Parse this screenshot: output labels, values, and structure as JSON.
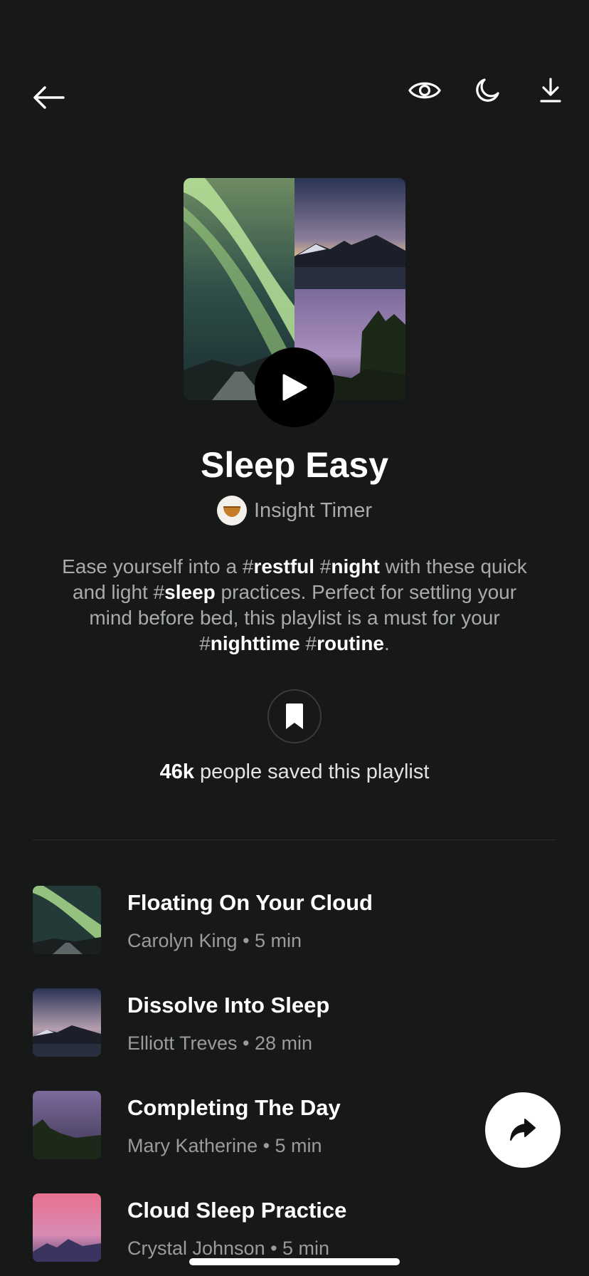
{
  "header": {
    "back_icon": "arrow-left-icon",
    "actions": [
      {
        "icon": "eye-icon"
      },
      {
        "icon": "moon-icon"
      },
      {
        "icon": "download-icon"
      }
    ]
  },
  "playlist": {
    "title": "Sleep Easy",
    "author": "Insight Timer",
    "description_parts": [
      {
        "text": "Ease yourself into a ",
        "tag": false
      },
      {
        "text": "#",
        "tag": false
      },
      {
        "text": "restful",
        "tag": true
      },
      {
        "text": " #",
        "tag": false
      },
      {
        "text": "night",
        "tag": true
      },
      {
        "text": " with these quick and light #",
        "tag": false
      },
      {
        "text": "sleep",
        "tag": true
      },
      {
        "text": " practices. Perfect for settling your mind before bed, this playlist is a must for your #",
        "tag": false
      },
      {
        "text": "nighttime",
        "tag": true
      },
      {
        "text": " #",
        "tag": false
      },
      {
        "text": "routine",
        "tag": true
      },
      {
        "text": ".",
        "tag": false
      }
    ],
    "saved_count": "46k",
    "saved_suffix": " people saved this playlist"
  },
  "tracks": [
    {
      "title": "Floating On Your Cloud",
      "meta": "Carolyn King • 5 min",
      "thumb": "aurora"
    },
    {
      "title": "Dissolve Into Sleep",
      "meta": "Elliott Treves • 28 min",
      "thumb": "mountains"
    },
    {
      "title": "Completing The Day",
      "meta": "Mary Katherine • 5 min",
      "thumb": "forest"
    },
    {
      "title": "Cloud Sleep Practice",
      "meta": "Crystal Johnson • 5 min",
      "thumb": "sunset"
    }
  ],
  "colors": {
    "background": "#171818",
    "text_primary": "#ffffff",
    "text_secondary": "#a9abab"
  }
}
